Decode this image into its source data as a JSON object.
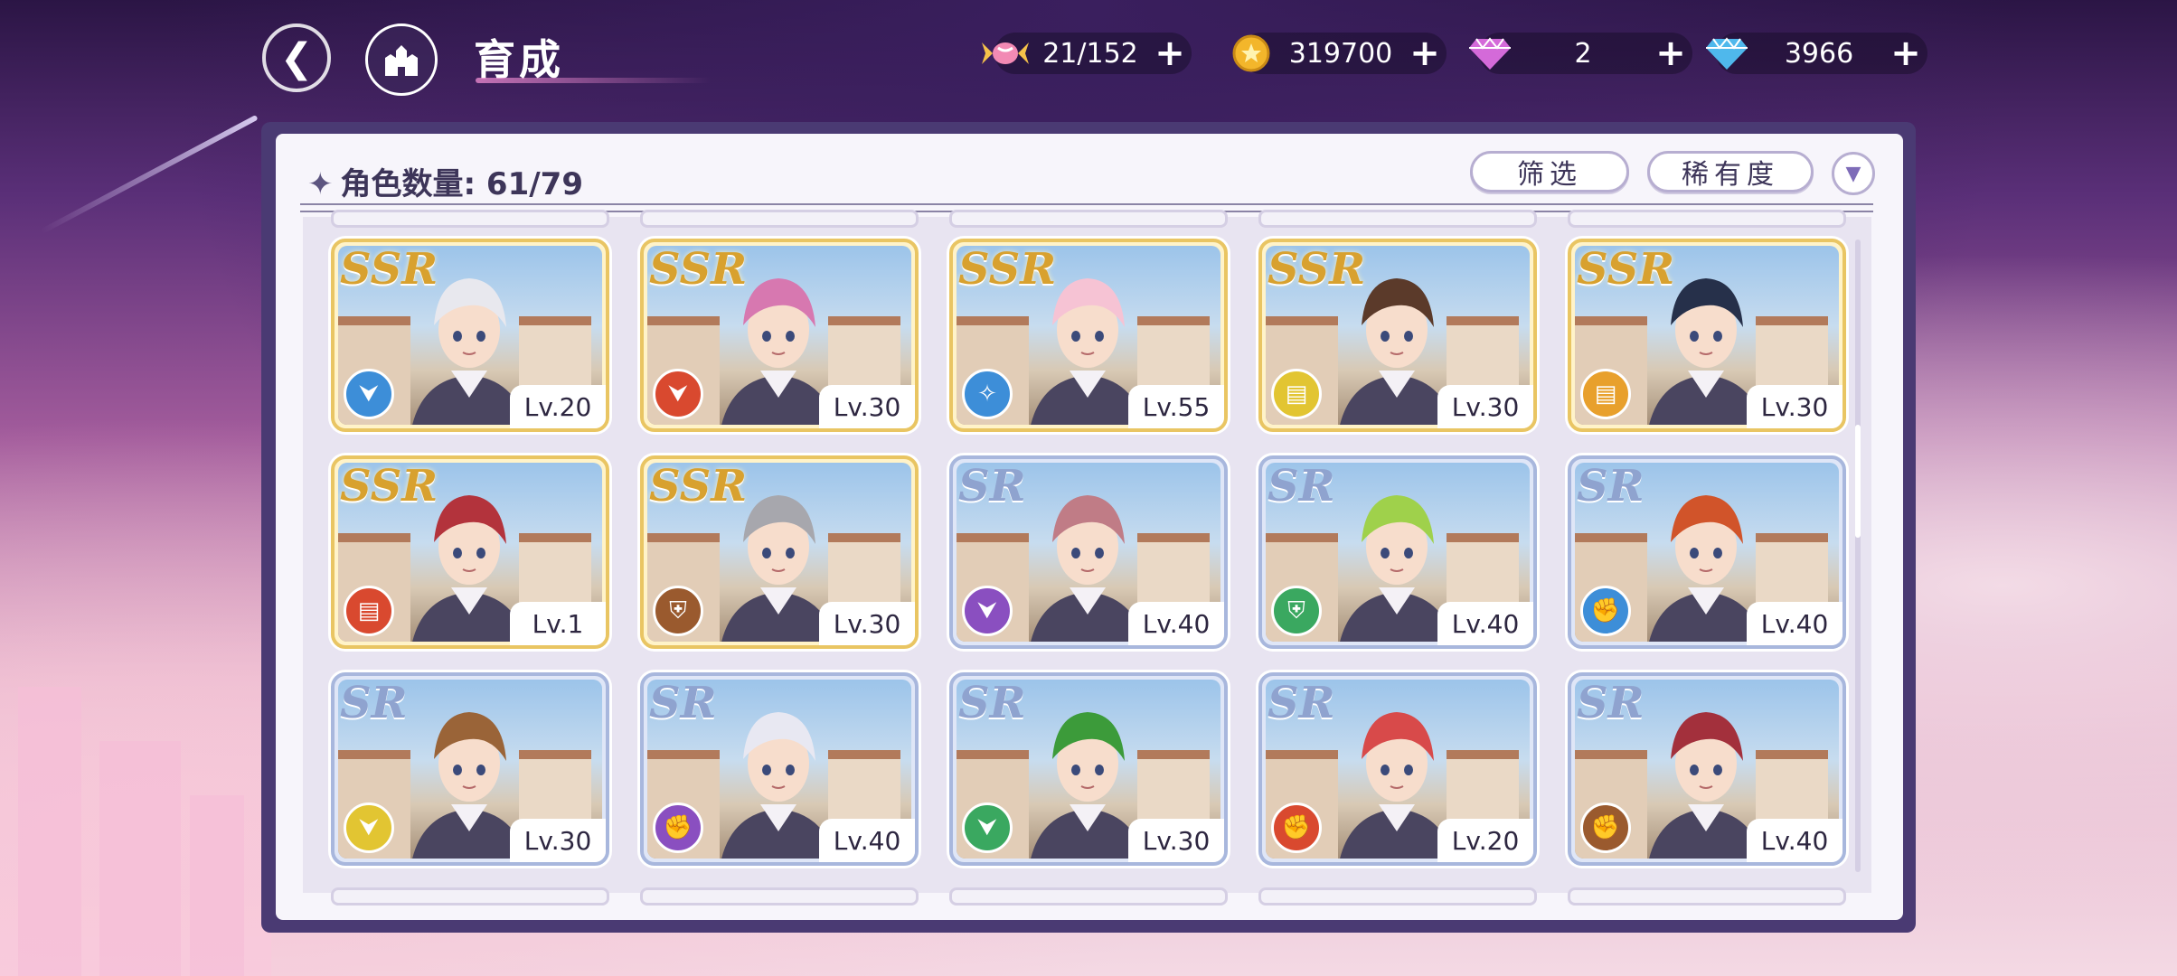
{
  "header": {
    "title": "育成",
    "resources": [
      {
        "icon": "candy-icon",
        "value": "21/152"
      },
      {
        "icon": "gold-coin-icon",
        "value": "319700"
      },
      {
        "icon": "pink-gem-icon",
        "value": "2"
      },
      {
        "icon": "blue-diamond-icon",
        "value": "3966"
      }
    ]
  },
  "panel": {
    "count_label": "角色数量: 61/79",
    "filter_label": "筛选",
    "sort_label": "稀有度"
  },
  "cards": [
    {
      "rarity": "SSR",
      "level": "Lv.20",
      "element_color": "#3d8ed8",
      "icon": "boot-icon"
    },
    {
      "rarity": "SSR",
      "level": "Lv.30",
      "element_color": "#d9492f",
      "icon": "boot-icon"
    },
    {
      "rarity": "SSR",
      "level": "Lv.55",
      "element_color": "#3d8ed8",
      "icon": "wand-icon"
    },
    {
      "rarity": "SSR",
      "level": "Lv.30",
      "element_color": "#e2c532",
      "icon": "book-icon"
    },
    {
      "rarity": "SSR",
      "level": "Lv.30",
      "element_color": "#e8a02c",
      "icon": "book-icon"
    },
    {
      "rarity": "SSR",
      "level": "Lv.1",
      "element_color": "#d9492f",
      "icon": "book-icon"
    },
    {
      "rarity": "SSR",
      "level": "Lv.30",
      "element_color": "#9a5a2e",
      "icon": "shield-icon"
    },
    {
      "rarity": "SR",
      "level": "Lv.40",
      "element_color": "#8a4fc0",
      "icon": "boot-icon"
    },
    {
      "rarity": "SR",
      "level": "Lv.40",
      "element_color": "#3aa860",
      "icon": "shield-icon"
    },
    {
      "rarity": "SR",
      "level": "Lv.40",
      "element_color": "#3d8ed8",
      "icon": "fist-icon"
    },
    {
      "rarity": "SR",
      "level": "Lv.30",
      "element_color": "#e2c532",
      "icon": "boot-icon"
    },
    {
      "rarity": "SR",
      "level": "Lv.40",
      "element_color": "#8a4fc0",
      "icon": "fist-icon"
    },
    {
      "rarity": "SR",
      "level": "Lv.30",
      "element_color": "#3aa860",
      "icon": "boot-icon"
    },
    {
      "rarity": "SR",
      "level": "Lv.20",
      "element_color": "#d9492f",
      "icon": "fist-icon"
    },
    {
      "rarity": "SR",
      "level": "Lv.40",
      "element_color": "#9a5a2e",
      "icon": "fist-icon"
    }
  ]
}
